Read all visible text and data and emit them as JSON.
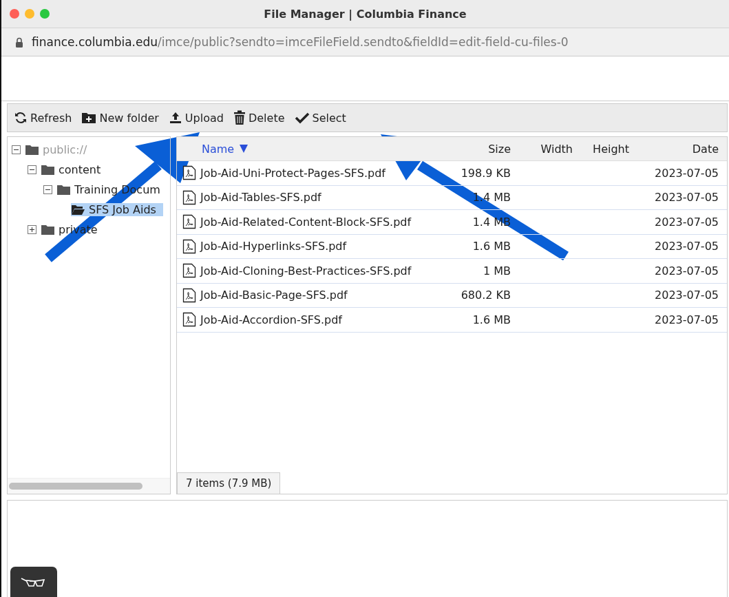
{
  "window": {
    "title": "File Manager | Columbia Finance"
  },
  "address_bar": {
    "host": "finance.columbia.edu",
    "path": "/imce/public?sendto=imceFileField.sendto&fieldId=edit-field-cu-files-0"
  },
  "toolbar": [
    {
      "kind": "refresh",
      "label": "Refresh"
    },
    {
      "kind": "new-folder",
      "label": "New folder"
    },
    {
      "kind": "upload",
      "label": "Upload"
    },
    {
      "kind": "delete",
      "label": "Delete"
    },
    {
      "kind": "select",
      "label": "Select"
    }
  ],
  "folder_tree": [
    {
      "label": "public://",
      "expanded": true,
      "selected": false,
      "children": [
        {
          "label": "content",
          "expanded": true,
          "selected": false,
          "children": [
            {
              "label": "Training Docum",
              "expanded": true,
              "selected": false,
              "children": [
                {
                  "label": "SFS Job Aids",
                  "selected": true
                }
              ]
            }
          ]
        },
        {
          "label": "private",
          "expanded": false,
          "selected": false
        }
      ]
    }
  ],
  "table": {
    "columns": [
      {
        "label": "Name",
        "sorted": true
      },
      {
        "label": "Size",
        "sorted": false
      },
      {
        "label": "Width",
        "sorted": false
      },
      {
        "label": "Height",
        "sorted": false
      },
      {
        "label": "Date",
        "sorted": false
      }
    ],
    "rows": [
      {
        "name": "Job-Aid-Uni-Protect-Pages-SFS.pdf",
        "size": "198.9 KB",
        "date": "2023-07-05"
      },
      {
        "name": "Job-Aid-Tables-SFS.pdf",
        "size": "1.4 MB",
        "date": "2023-07-05"
      },
      {
        "name": "Job-Aid-Related-Content-Block-SFS.pdf",
        "size": "1.4 MB",
        "date": "2023-07-05"
      },
      {
        "name": "Job-Aid-Hyperlinks-SFS.pdf",
        "size": "1.6 MB",
        "date": "2023-07-05"
      },
      {
        "name": "Job-Aid-Cloning-Best-Practices-SFS.pdf",
        "size": "1 MB",
        "date": "2023-07-05"
      },
      {
        "name": "Job-Aid-Basic-Page-SFS.pdf",
        "size": "680.2 KB",
        "date": "2023-07-05"
      },
      {
        "name": "Job-Aid-Accordion-SFS.pdf",
        "size": "1.6 MB",
        "date": "2023-07-05"
      }
    ]
  },
  "status_bar": {
    "summary": "7 items (7.9 MB)"
  }
}
